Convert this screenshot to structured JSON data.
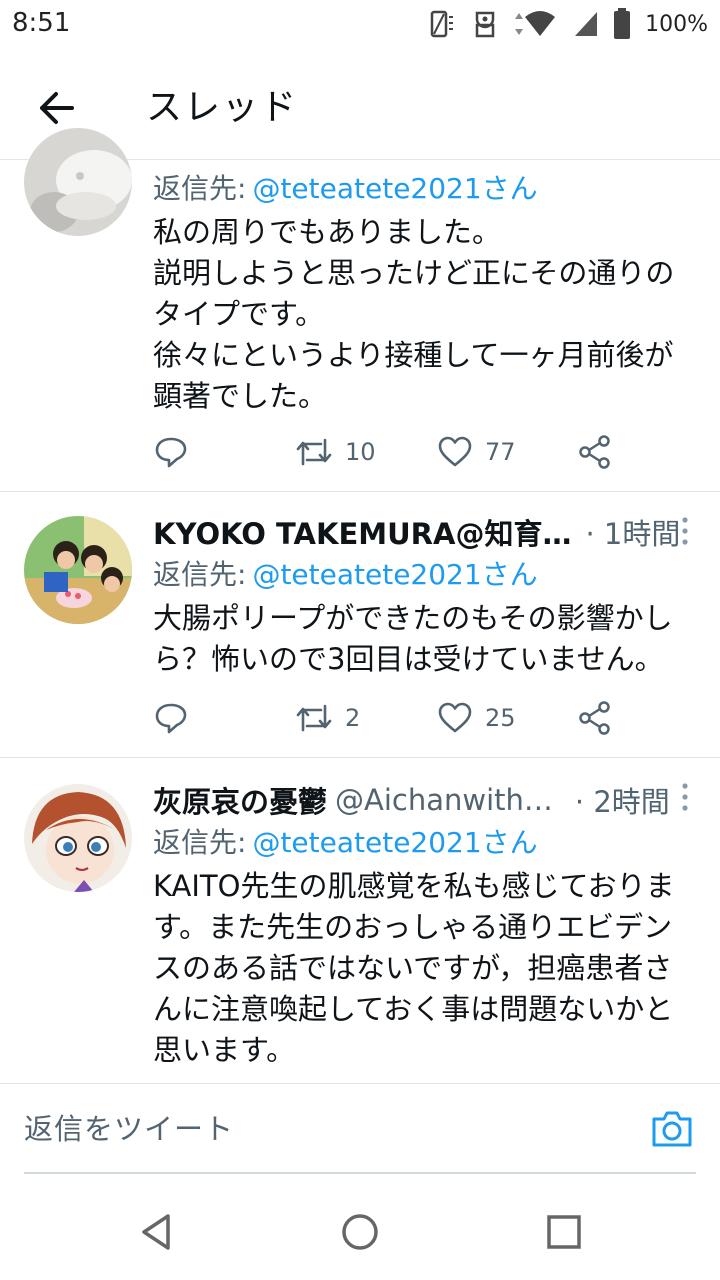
{
  "status_bar": {
    "time": "8:51",
    "battery": "100%"
  },
  "header": {
    "title": "スレッド"
  },
  "tweets": [
    {
      "reply_label": "返信先:",
      "reply_to": "@teteatete2021さん",
      "text": [
        "私の周りでもありました。",
        "説明しようと思ったけど正にその通りのタイプです。",
        "徐々にというより接種して一ヶ月前後が顕著でした。"
      ],
      "retweets": "10",
      "likes": "77"
    },
    {
      "name": "KYOKO TAKEMURA@知育…",
      "time": "· 1時間",
      "reply_label": "返信先:",
      "reply_to": "@teteatete2021さん",
      "text": [
        "大腸ポリープができたのもその影響かしら？怖いので3回目は受けていません。"
      ],
      "retweets": "2",
      "likes": "25"
    },
    {
      "name": "灰原哀の憂鬱",
      "handle": "@Aichanwith…",
      "time": "· 2時間",
      "reply_label": "返信先:",
      "reply_to": "@teteatete2021さん",
      "text": [
        "KAITO先生の肌感覚を私も感じております。また先生のおっしゃる通りエビデンスのある話ではないですが，担癌患者さんに注意喚起しておく事は問題ないかと思います。"
      ]
    }
  ],
  "compose": {
    "placeholder": "返信をツイート"
  },
  "colors": {
    "accent": "#1d9bf0",
    "secondary_text": "#536471"
  }
}
